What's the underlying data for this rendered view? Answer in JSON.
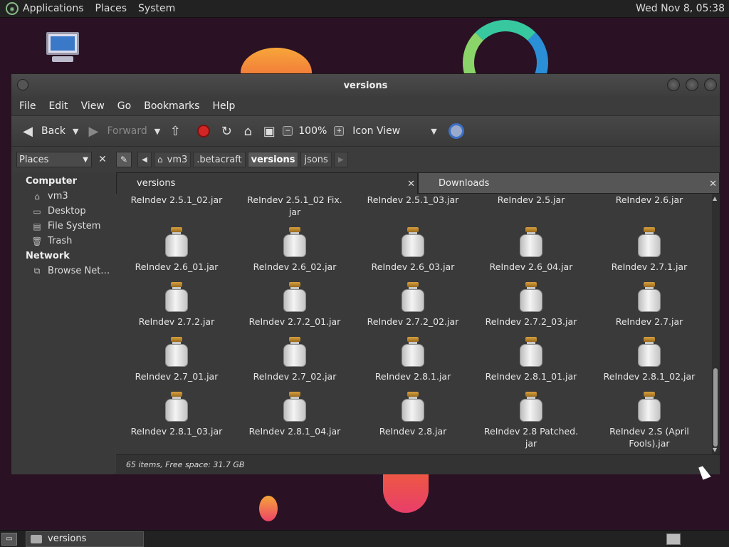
{
  "top_panel": {
    "menus": [
      "Applications",
      "Places",
      "System"
    ],
    "clock": "Wed Nov 8, 05:38"
  },
  "desktop": {
    "icons": [
      "computer-icon"
    ]
  },
  "window": {
    "title": "versions",
    "menubar": [
      "File",
      "Edit",
      "View",
      "Go",
      "Bookmarks",
      "Help"
    ],
    "toolbar": {
      "back": "Back",
      "forward": "Forward",
      "zoom": "100%",
      "view": "Icon View"
    },
    "location": {
      "places_label": "Places",
      "crumbs": [
        "vm3",
        ".betacraft",
        "versions",
        "jsons"
      ]
    },
    "sidebar": {
      "computer_header": "Computer",
      "computer_items": [
        "vm3",
        "Desktop",
        "File System",
        "Trash"
      ],
      "network_header": "Network",
      "network_items": [
        "Browse Net…"
      ]
    },
    "tabs": [
      "versions",
      "Downloads"
    ],
    "files": [
      "ReIndev 2.5.1_02.jar",
      "ReIndev 2.5.1_02 Fix.\njar",
      "ReIndev 2.5.1_03.jar",
      "ReIndev 2.5.jar",
      "ReIndev 2.6.jar",
      "ReIndev 2.6_01.jar",
      "ReIndev 2.6_02.jar",
      "ReIndev 2.6_03.jar",
      "ReIndev 2.6_04.jar",
      "ReIndev 2.7.1.jar",
      "ReIndev 2.7.2.jar",
      "ReIndev 2.7.2_01.jar",
      "ReIndev 2.7.2_02.jar",
      "ReIndev 2.7.2_03.jar",
      "ReIndev 2.7.jar",
      "ReIndev 2.7_01.jar",
      "ReIndev 2.7_02.jar",
      "ReIndev 2.8.1.jar",
      "ReIndev 2.8.1_01.jar",
      "ReIndev 2.8.1_02.jar",
      "ReIndev 2.8.1_03.jar",
      "ReIndev 2.8.1_04.jar",
      "ReIndev 2.8.jar",
      "ReIndev 2.8 Patched.\njar",
      "ReIndev 2.S (April\nFools).jar"
    ],
    "status": "65 items, Free space: 31.7 GB"
  },
  "taskbar": {
    "task": "versions"
  }
}
